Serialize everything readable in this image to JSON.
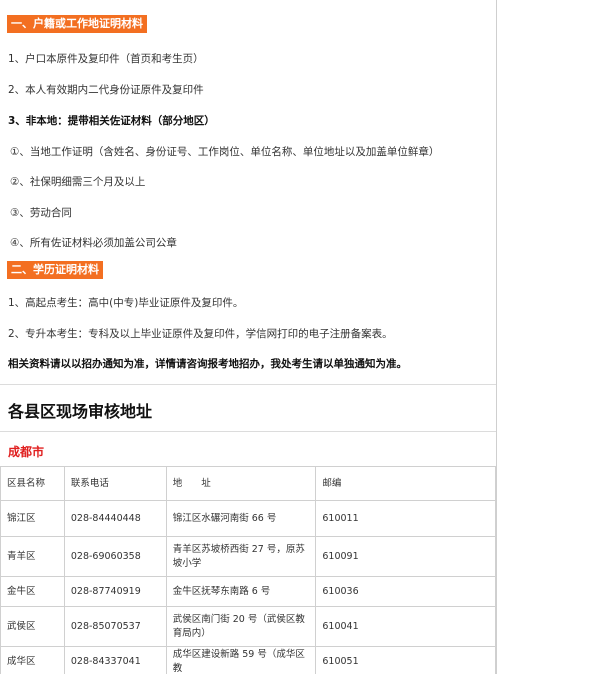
{
  "section1": {
    "header": "一、户籍或工作地证明材料",
    "items": [
      "1、户口本原件及复印件（首页和考生页）",
      "2、本人有效期内二代身份证原件及复印件",
      "3、非本地：提带相关佐证材料（部分地区）"
    ],
    "subitems": [
      "①、当地工作证明（含姓名、身份证号、工作岗位、单位名称、单位地址以及加盖单位鲜章）",
      "②、社保明细需三个月及以上",
      "③、劳动合同",
      "④、所有佐证材料必须加盖公司公章"
    ]
  },
  "section2": {
    "header": "二、学历证明材料",
    "items": [
      "1、高起点考生：高中(中专)毕业证原件及复印件。",
      "2、专升本考生：专科及以上毕业证原件及复印件，学信网打印的电子注册备案表。"
    ],
    "note": "相关资料请以以招办通知为准，详情请咨询报考地招办，我处考生请以单独通知为准。"
  },
  "address_title": "各县区现场审核地址",
  "city": "成都市",
  "table": {
    "headers": [
      "区县名称",
      "联系电话",
      "地　　址",
      "邮编"
    ],
    "rows": [
      [
        "锦江区",
        "028-84440448",
        "锦江区水碾河南街 66 号",
        "610011"
      ],
      [
        "青羊区",
        "028-69060358",
        "青羊区苏坡桥西街 27 号，原苏坡小学",
        "610091"
      ],
      [
        "金牛区",
        "028-87740919",
        "金牛区抚琴东南路 6 号",
        "610036"
      ],
      [
        "武侯区",
        "028-85070537",
        "武侯区南门街 20 号（武侯区教育局内）",
        "610041"
      ],
      [
        "成华区",
        "028-84337041",
        "成华区建设新路 59 号（成华区教",
        "610051"
      ]
    ]
  }
}
